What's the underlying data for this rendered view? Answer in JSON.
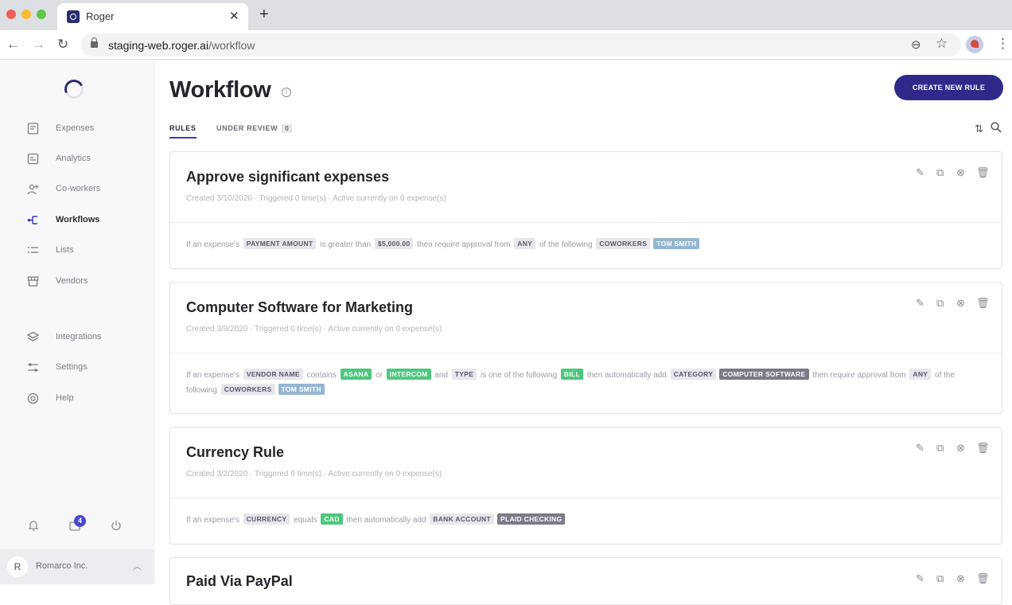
{
  "browser": {
    "tab_title": "Roger",
    "url_host": "staging-web.roger.ai",
    "url_path": "/workflow"
  },
  "sidebar": {
    "items": [
      {
        "label": "Expenses",
        "icon": "receipt-icon"
      },
      {
        "label": "Analytics",
        "icon": "analytics-icon"
      },
      {
        "label": "Co-workers",
        "icon": "add-user-icon"
      },
      {
        "label": "Workflows",
        "icon": "workflow-icon",
        "active": true
      },
      {
        "label": "Lists",
        "icon": "list-icon"
      },
      {
        "label": "Vendors",
        "icon": "store-icon"
      },
      {
        "label": "Integrations",
        "icon": "layers-icon"
      },
      {
        "label": "Settings",
        "icon": "sliders-icon"
      },
      {
        "label": "Help",
        "icon": "help-icon"
      }
    ],
    "notifications_badge": "4",
    "org": {
      "avatar": "R",
      "name": "Romarco Inc."
    }
  },
  "main": {
    "title": "Workflow",
    "create_button": "CREATE NEW RULE",
    "tabs": [
      {
        "label": "RULES",
        "active": true
      },
      {
        "label": "UNDER REVIEW",
        "count": "0"
      }
    ]
  },
  "rules": [
    {
      "title": "Approve significant expenses",
      "meta": "Created 3/10/2020 · Triggered 0 time(s) · Active currently on 0 expense(s)",
      "tokens": [
        {
          "t": "If an expense's"
        },
        {
          "chip": "PAYMENT AMOUNT",
          "style": "gray"
        },
        {
          "t": "is greater than"
        },
        {
          "chip": "$5,000.00",
          "style": "gray"
        },
        {
          "t": "then require approval from"
        },
        {
          "chip": "ANY",
          "style": "gray"
        },
        {
          "t": "of the following"
        },
        {
          "chip": "COWORKERS",
          "style": "gray"
        },
        {
          "chip": "TOM SMITH",
          "style": "blue"
        }
      ]
    },
    {
      "title": "Computer Software for Marketing",
      "meta": "Created 3/9/2020 · Triggered 0 time(s) · Active currently on 0 expense(s)",
      "tokens": [
        {
          "t": "If an expense's"
        },
        {
          "chip": "VENDOR NAME",
          "style": "gray"
        },
        {
          "t": "contains"
        },
        {
          "chip": "ASANA",
          "style": "green"
        },
        {
          "t": "or"
        },
        {
          "chip": "INTERCOM",
          "style": "green"
        },
        {
          "t": "and"
        },
        {
          "chip": "TYPE",
          "style": "gray"
        },
        {
          "t": "is one of the following"
        },
        {
          "chip": "BILL",
          "style": "green"
        },
        {
          "t": "then automatically add"
        },
        {
          "chip": "CATEGORY",
          "style": "gray"
        },
        {
          "chip": "COMPUTER SOFTWARE",
          "style": "dark"
        },
        {
          "t": "then require approval from"
        },
        {
          "chip": "ANY",
          "style": "gray"
        },
        {
          "t": "of the following"
        },
        {
          "chip": "COWORKERS",
          "style": "gray"
        },
        {
          "chip": "TOM SMITH",
          "style": "blue"
        }
      ]
    },
    {
      "title": "Currency Rule",
      "meta": "Created 3/2/2020 · Triggered 0 time(s) · Active currently on 0 expense(s)",
      "tokens": [
        {
          "t": "If an expense's"
        },
        {
          "chip": "CURRENCY",
          "style": "gray"
        },
        {
          "t": "equals"
        },
        {
          "chip": "CAD",
          "style": "green"
        },
        {
          "t": "then automatically add"
        },
        {
          "chip": "BANK ACCOUNT",
          "style": "gray"
        },
        {
          "chip": "PLAID CHECKING",
          "style": "dark"
        }
      ]
    },
    {
      "title": "Paid Via PayPal",
      "meta": "",
      "tokens": []
    }
  ]
}
